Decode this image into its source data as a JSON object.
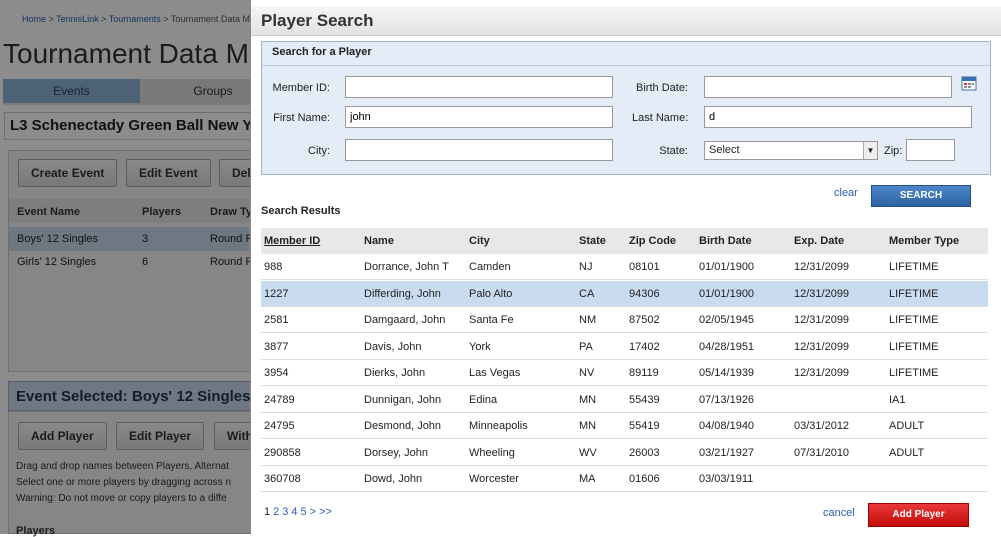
{
  "background": {
    "breadcrumb": [
      "Home",
      "TennisLink",
      "Tournaments",
      "Tournament Data M"
    ],
    "page_title": "Tournament Data Man",
    "tabs": [
      "Events",
      "Groups"
    ],
    "event_title": "L3 Schenectady Green Ball New Y",
    "buttons": [
      "Create Event",
      "Edit Event",
      "Del"
    ],
    "table_headers": [
      "Event Name",
      "Players",
      "Draw Ty"
    ],
    "events": [
      {
        "name": "Boys' 12 Singles",
        "players": "3",
        "draw": "Round R"
      },
      {
        "name": "Girls' 12 Singles",
        "players": "6",
        "draw": "Round R"
      }
    ],
    "event_selected": "Event Selected: Boys' 12 Singles",
    "player_buttons": [
      "Add Player",
      "Edit Player",
      "With"
    ],
    "notes": [
      "Drag and drop names between Players, Alternat",
      "Select one or more players by dragging across n",
      "Warning: Do not move or copy players to a diffe"
    ],
    "players_label": "Players"
  },
  "modal": {
    "title": "Player Search",
    "section_title": "Search for a Player",
    "labels": {
      "member_id": "Member ID:",
      "birth_date": "Birth Date:",
      "first_name": "First Name:",
      "last_name": "Last Name:",
      "city": "City:",
      "state": "State:",
      "zip": "Zip:"
    },
    "values": {
      "member_id": "",
      "birth_date": "",
      "first_name": "john",
      "last_name": "d",
      "city": "",
      "state": "Select",
      "zip": ""
    },
    "clear_label": "clear",
    "search_label": "SEARCH",
    "results_label": "Search Results",
    "columns": [
      "Member ID",
      "Name",
      "City",
      "State",
      "Zip Code",
      "Birth Date",
      "Exp. Date",
      "Member Type"
    ],
    "rows": [
      [
        "988",
        "Dorrance, John T",
        "Camden",
        "NJ",
        "08101",
        "01/01/1900",
        "12/31/2099",
        "LIFETIME"
      ],
      [
        "1227",
        "Differding, John",
        "Palo Alto",
        "CA",
        "94306",
        "01/01/1900",
        "12/31/2099",
        "LIFETIME"
      ],
      [
        "2581",
        "Damgaard, John",
        "Santa Fe",
        "NM",
        "87502",
        "02/05/1945",
        "12/31/2099",
        "LIFETIME"
      ],
      [
        "3877",
        "Davis, John",
        "York",
        "PA",
        "17402",
        "04/28/1951",
        "12/31/2099",
        "LIFETIME"
      ],
      [
        "3954",
        "Dierks, John",
        "Las Vegas",
        "NV",
        "89119",
        "05/14/1939",
        "12/31/2099",
        "LIFETIME"
      ],
      [
        "24789",
        "Dunnigan, John",
        "Edina",
        "MN",
        "55439",
        "07/13/1926",
        "",
        "IA1"
      ],
      [
        "24795",
        "Desmond, John",
        "Minneapolis",
        "MN",
        "55419",
        "04/08/1940",
        "03/31/2012",
        "ADULT"
      ],
      [
        "290858",
        "Dorsey, John",
        "Wheeling",
        "WV",
        "26003",
        "03/21/1927",
        "07/31/2010",
        "ADULT"
      ],
      [
        "360708",
        "Dowd, John",
        "Worcester",
        "MA",
        "01606",
        "03/03/1911",
        "",
        ""
      ]
    ],
    "highlighted_row": 1,
    "pagination": [
      "1",
      "2",
      "3",
      "4",
      "5",
      ">",
      ">>"
    ],
    "current_page": "1",
    "cancel_label": "cancel",
    "add_player_label": "Add Player"
  }
}
